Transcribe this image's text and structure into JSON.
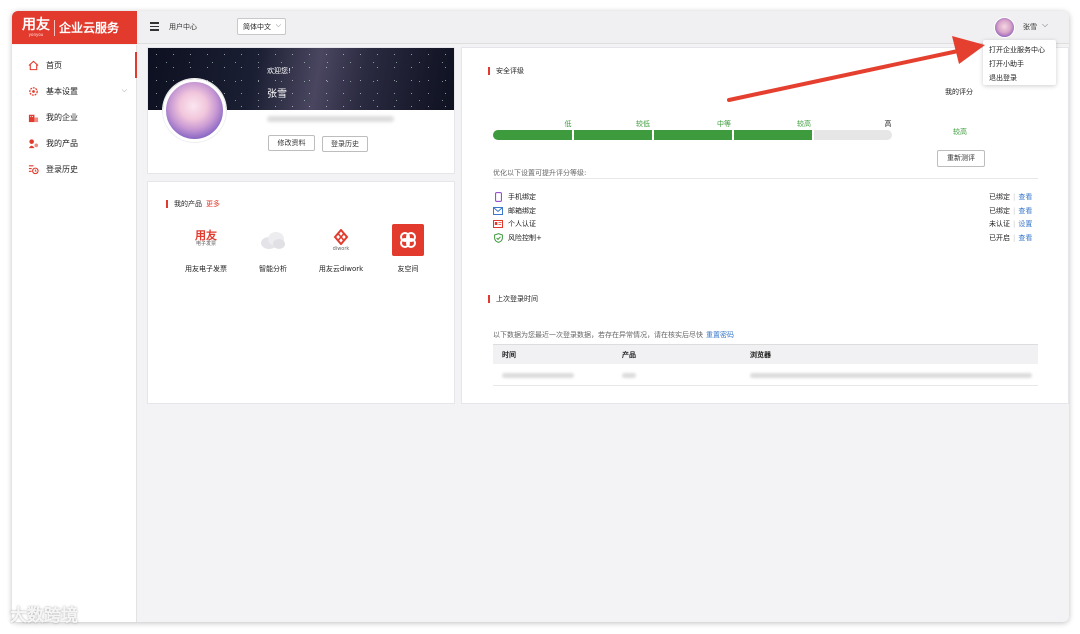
{
  "header": {
    "logo_mark": "用友",
    "logo_sub": "yonyou",
    "logo_text": "企业云服务",
    "title": "用户中心",
    "language": "简体中文",
    "user_name": "张雪"
  },
  "user_menu": {
    "items": [
      "打开企业服务中心",
      "打开小助手",
      "退出登录"
    ]
  },
  "sidebar": {
    "items": [
      {
        "label": "首页",
        "icon": "home-icon"
      },
      {
        "label": "基本设置",
        "icon": "gear-icon"
      },
      {
        "label": "我的企业",
        "icon": "building-icon"
      },
      {
        "label": "我的产品",
        "icon": "product-icon"
      },
      {
        "label": "登录历史",
        "icon": "history-icon"
      }
    ]
  },
  "profile": {
    "welcome": "欢迎您!",
    "name": "张雪",
    "edit_button": "修改资料",
    "history_button": "登录历史"
  },
  "products": {
    "title": "我的产品",
    "more": "更多",
    "items": [
      {
        "label": "用友电子发票",
        "icon": "yonyou-invoice-icon",
        "icon_text": "用友",
        "icon_sub": "电子发票"
      },
      {
        "label": "智能分析",
        "icon": "cloud-analysis-icon"
      },
      {
        "label": "用友云diwork",
        "icon": "diwork-icon",
        "icon_sub": "diwork"
      },
      {
        "label": "友空间",
        "icon": "youspace-icon"
      }
    ]
  },
  "security": {
    "title": "安全评级",
    "my_score_label": "我的评分",
    "levels": [
      "低",
      "较低",
      "中等",
      "较高",
      "高"
    ],
    "score_level": "较高",
    "score_fraction": 0.8,
    "retest_button": "重新测评",
    "hint": "优化以下设置可提升评分等级:",
    "items": [
      {
        "label": "手机绑定",
        "icon": "phone-icon",
        "status": "已绑定",
        "action": "查看"
      },
      {
        "label": "邮箱绑定",
        "icon": "mail-icon",
        "status": "已绑定",
        "action": "查看"
      },
      {
        "label": "个人认证",
        "icon": "id-card-icon",
        "status": "未认证",
        "action": "设置"
      },
      {
        "label": "风险控制+",
        "icon": "shield-icon",
        "status": "已开启",
        "action": "查看"
      }
    ]
  },
  "login": {
    "title": "上次登录时间",
    "desc": "以下数据为您最近一次登录数据，若存在异常情况，请在核实后尽快",
    "reset_link": "重置密码",
    "columns": [
      "时间",
      "产品",
      "浏览器"
    ]
  },
  "watermark": "大数跨境",
  "colors": {
    "brand_red": "#e23b2e",
    "safe_green": "#3d9a3d",
    "link_blue": "#3a78c9",
    "arrow_red": "#e5402f"
  }
}
